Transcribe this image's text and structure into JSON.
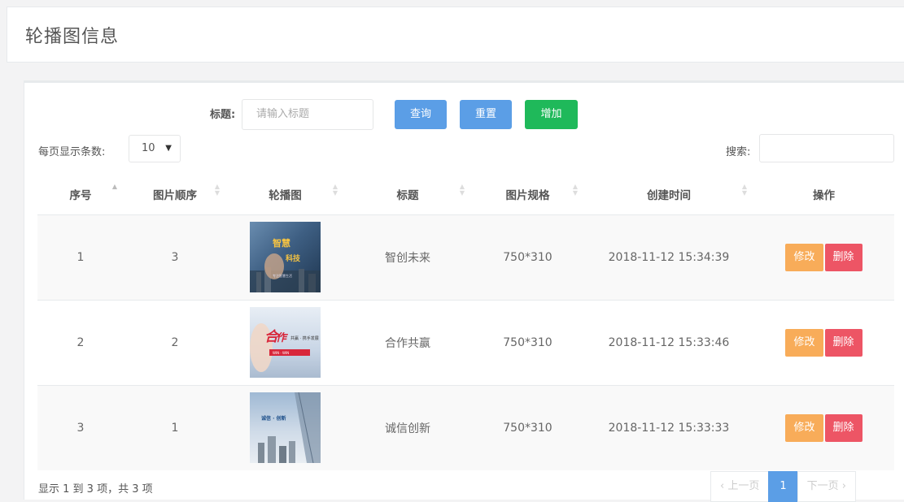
{
  "header": {
    "title": "轮播图信息"
  },
  "filter": {
    "title_label": "标题:",
    "title_placeholder": "请输入标题",
    "query_label": "查询",
    "reset_label": "重置",
    "add_label": "增加"
  },
  "table_controls": {
    "page_length_label": "每页显示条数:",
    "page_length_value": "10",
    "search_label": "搜索:"
  },
  "table": {
    "columns": [
      "序号",
      "图片顺序",
      "轮播图",
      "标题",
      "图片规格",
      "创建时间",
      "操作"
    ],
    "rows": [
      {
        "index": "1",
        "order": "3",
        "image": "carousel-image-1",
        "title": "智创未来",
        "spec": "750*310",
        "created": "2018-11-12 15:34:39",
        "edit": "修改",
        "delete": "删除"
      },
      {
        "index": "2",
        "order": "2",
        "image": "carousel-image-2",
        "title": "合作共赢",
        "spec": "750*310",
        "created": "2018-11-12 15:33:46",
        "edit": "修改",
        "delete": "删除"
      },
      {
        "index": "3",
        "order": "1",
        "image": "carousel-image-3",
        "title": "诚信创新",
        "spec": "750*310",
        "created": "2018-11-12 15:33:33",
        "edit": "修改",
        "delete": "删除"
      }
    ]
  },
  "footer": {
    "info": "显示 1 到 3 项，共 3 项",
    "prev_label": "‹ 上一页",
    "current_page": "1",
    "next_label": "下一页 ›"
  },
  "colors": {
    "primary": "#5b9ee6",
    "success": "#1fb95a",
    "warning": "#f8ac59",
    "danger": "#ed5565"
  }
}
